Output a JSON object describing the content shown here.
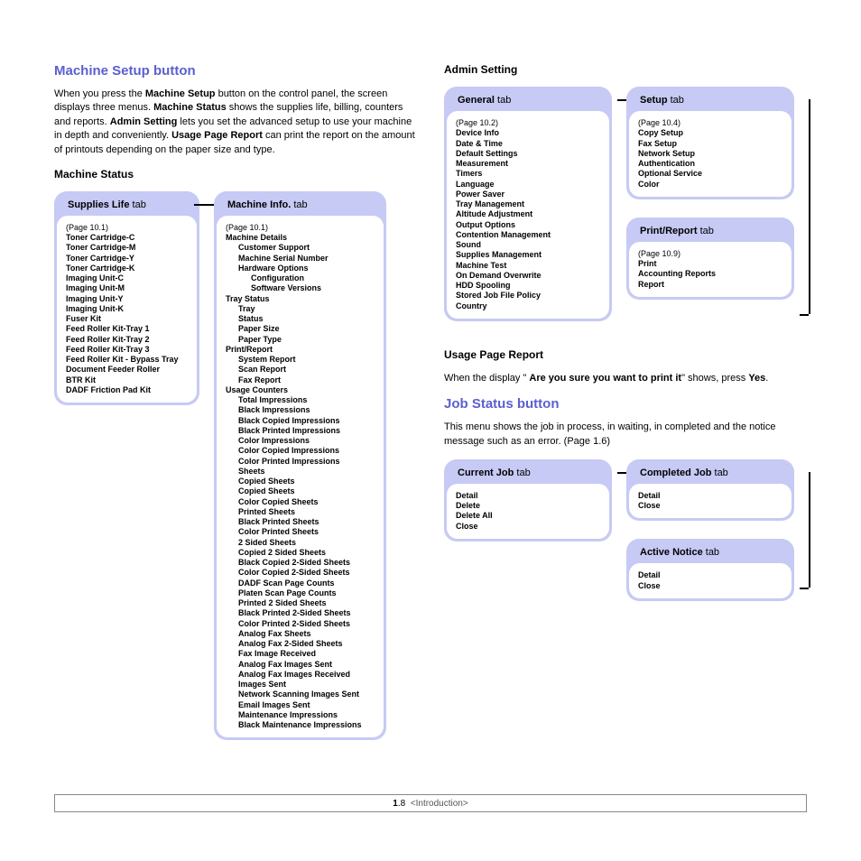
{
  "left": {
    "title": "Machine Setup button",
    "intro_parts": [
      "When you press the ",
      "Machine Setup",
      " button on the control panel, the screen displays three menus. ",
      "Machine Status",
      " shows the supplies life, billing, counters and reports. ",
      "Admin Setting",
      " lets you set the advanced setup to use your machine in depth and conveniently. ",
      "Usage Page Report",
      " can print the report on the amount of printouts depending on the paper size and type."
    ],
    "machine_status_title": "Machine Status",
    "supplies_tab": {
      "title_b": "Supplies Life",
      "title_n": " tab"
    },
    "supplies_page": "(Page 10.1)",
    "supplies_items": [
      "Toner Cartridge-C",
      "Toner Cartridge-M",
      "Toner Cartridge-Y",
      "Toner Cartridge-K",
      "Imaging Unit-C",
      "Imaging Unit-M",
      "Imaging Unit-Y",
      "Imaging Unit-K",
      "Fuser Kit",
      "Feed Roller Kit-Tray 1",
      "Feed Roller Kit-Tray 2",
      "Feed Roller Kit-Tray 3",
      "Feed Roller Kit - Bypass Tray",
      "Document Feeder Roller",
      "BTR Kit",
      "DADF Friction Pad Kit"
    ],
    "machine_info_tab": {
      "title_b": "Machine Info.",
      "title_n": " tab"
    },
    "machine_info_page": "(Page 10.1)",
    "machine_info": {
      "machine_details": "Machine Details",
      "md_sub": [
        "Customer Support",
        "Machine Serial Number",
        "Hardware Options",
        "Configuration",
        "Software Versions"
      ],
      "tray_status": "Tray Status",
      "ts_sub": [
        "Tray",
        "Status",
        "Paper Size",
        "Paper Type"
      ],
      "print_report": "Print/Report",
      "pr_sub": [
        "System Report",
        "Scan Report",
        "Fax Report"
      ],
      "usage_counters": "Usage Counters",
      "uc_sub": [
        "Total Impressions",
        "Black Impressions",
        "Black Copied Impressions",
        "Black Printed Impressions",
        "Color Impressions",
        "Color Copied Impressions",
        "Color Printed Impressions",
        "Sheets",
        "Copied Sheets",
        "Copied Sheets",
        "Color Copied Sheets",
        "Printed Sheets",
        "Black Printed Sheets",
        "Color Printed Sheets",
        "2 Sided Sheets",
        "Copied 2 Sided Sheets",
        "Black Copied 2-Sided Sheets",
        "Color Copied 2-Sided Sheets",
        "DADF Scan Page Counts",
        "Platen Scan Page Counts",
        "Printed 2 Sided Sheets",
        "Black Printed 2-Sided Sheets",
        "Color Printed 2-Sided Sheets",
        "Analog Fax Sheets",
        "Analog Fax 2-Sided Sheets",
        "Fax Image Received",
        "Analog Fax Images Sent",
        "Analog Fax Images Received",
        "Images Sent",
        "Network Scanning Images Sent",
        "Email Images Sent",
        "Maintenance Impressions",
        "Black Maintenance Impressions"
      ]
    }
  },
  "right": {
    "admin_title": "Admin Setting",
    "general_tab": {
      "title_b": "General",
      "title_n": " tab"
    },
    "general_page": "(Page 10.2)",
    "general_items": [
      "Device Info",
      "Date & Time",
      "Default Settings",
      "Measurement",
      "Timers",
      "Language",
      "Power Saver",
      "Tray Management",
      "Altitude Adjustment",
      "Output Options",
      "Contention Management",
      "Sound",
      "Supplies Management",
      "Machine Test",
      "On Demand Overwrite",
      "HDD Spooling",
      "Stored Job File Policy",
      "Country"
    ],
    "setup_tab": {
      "title_b": "Setup",
      "title_n": " tab"
    },
    "setup_page": "(Page 10.4)",
    "setup_items": [
      "Copy Setup",
      "Fax Setup",
      "Network Setup",
      "Authentication",
      "Optional Service",
      "Color"
    ],
    "pr_tab": {
      "title_b": "Print/Report",
      "title_n": " tab"
    },
    "pr_page": "(Page 10.9)",
    "pr_items": [
      "Print",
      "Accounting Reports",
      "Report"
    ],
    "usage_title": "Usage Page Report",
    "usage_parts": [
      "When the display  \" ",
      "Are you sure you want to print it",
      "\" shows, press ",
      "Yes",
      "."
    ],
    "job_title": "Job Status button",
    "job_intro": "This menu shows the job in process, in waiting, in completed and the notice message such as an error. (Page 1.6)",
    "current_tab": {
      "title_b": "Current Job",
      "title_n": " tab"
    },
    "current_items": [
      "Detail",
      "Delete",
      "Delete All",
      "Close"
    ],
    "completed_tab": {
      "title_b": "Completed Job",
      "title_n": " tab"
    },
    "completed_items": [
      "Detail",
      "Close"
    ],
    "active_tab": {
      "title_b": "Active Notice",
      "title_n": " tab"
    },
    "active_items": [
      "Detail",
      "Close"
    ]
  },
  "footer": {
    "page_b": "1",
    "page_n": ".8",
    "section": "<Introduction>"
  }
}
